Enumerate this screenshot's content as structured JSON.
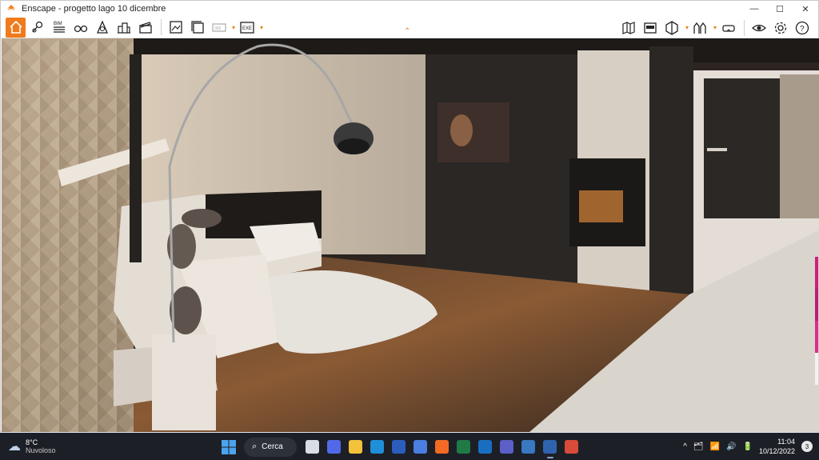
{
  "window": {
    "title": "Enscape - progetto lago 10 dicembre",
    "minimize": "—",
    "maximize": "☐",
    "close": "✕"
  },
  "toolbar": {
    "left_tools": [
      "home-icon",
      "pin-icon",
      "bim-icon",
      "binoculars-icon",
      "compass-icon",
      "buildings-icon",
      "clapper-icon"
    ],
    "export_tools": [
      "export-image-icon",
      "batch-render-icon",
      "panorama-icon",
      "exe-export-icon"
    ],
    "right_tools": [
      "map-icon",
      "video-editor-icon",
      "visual-settings-icon",
      "asset-library-icon",
      "vr-headset-icon",
      "view-icon",
      "settings-icon",
      "help-icon"
    ],
    "accent_color": "#f07b1c",
    "collapse_symbol": "⌃"
  },
  "viewport": {
    "description_type": "3d-render-living-room"
  },
  "taskbar": {
    "weather_temp": "8°C",
    "weather_condition": "Nuvoloso",
    "search_label": "Cerca",
    "time": "11:04",
    "date": "10/12/2022",
    "notification_count": "3",
    "tray_symbols": [
      "^",
      "🗂",
      "📶",
      "🔊",
      "🔋"
    ],
    "apps": [
      {
        "name": "task-view",
        "color": "#d8dde6"
      },
      {
        "name": "zoom",
        "color": "#5169e8"
      },
      {
        "name": "file-explorer",
        "color": "#f2c23a"
      },
      {
        "name": "edge",
        "color": "#1f8fd8"
      },
      {
        "name": "word",
        "color": "#2b5dbd"
      },
      {
        "name": "store",
        "color": "#4a7ee0"
      },
      {
        "name": "firefox",
        "color": "#f26a24"
      },
      {
        "name": "excel",
        "color": "#1f7a45"
      },
      {
        "name": "outlook",
        "color": "#1a6ec2"
      },
      {
        "name": "teams",
        "color": "#5b5fc7"
      },
      {
        "name": "sketchup",
        "color": "#3a78c2"
      },
      {
        "name": "enscape-active",
        "color": "#2f63b0"
      },
      {
        "name": "pdf-editor",
        "color": "#d84a3a"
      }
    ]
  }
}
